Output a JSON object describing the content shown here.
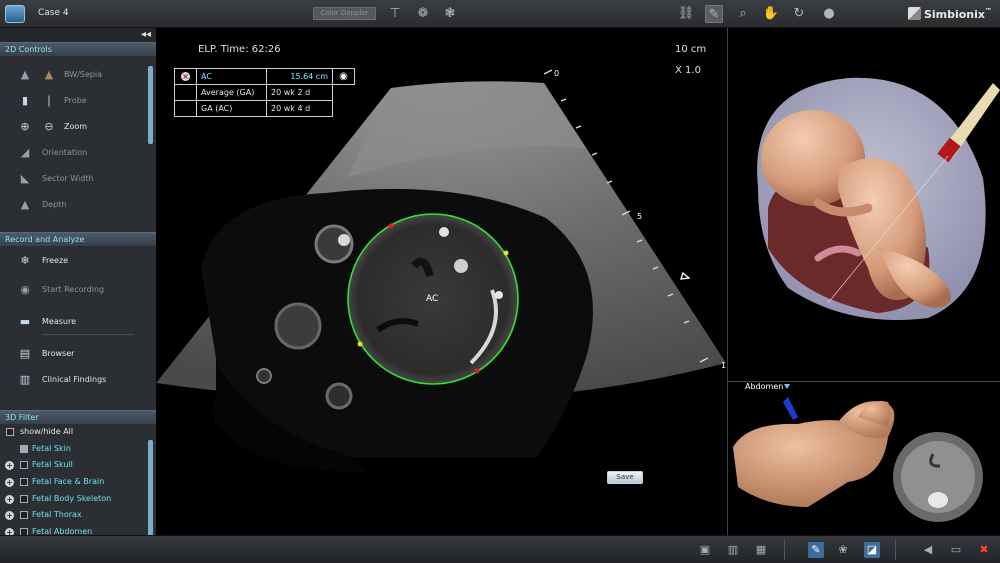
{
  "toolbar": {
    "case_title": "Case 4",
    "color_doppler": "Color Doppler",
    "brand": "Simbionix",
    "brand_suffix": "™"
  },
  "left_panel": {
    "collapse_icon": "double-left-arrow",
    "sections": {
      "controls_2d": "2D Controls",
      "record_analyze": "Record and Analyze",
      "filter_3d": "3D Filter"
    },
    "controls_2d": [
      {
        "label": "BW/Sepia",
        "icon": "sepia-icon"
      },
      {
        "label": "Probe",
        "icon": "probe-icon"
      },
      {
        "label": "Zoom",
        "icon": "zoom-icon"
      },
      {
        "label": "Orientation",
        "icon": "orientation-icon"
      },
      {
        "label": "Sector Width",
        "icon": "sector-width-icon"
      },
      {
        "label": "Depth",
        "icon": "depth-icon"
      }
    ],
    "record_analyze": [
      {
        "label": "Freeze",
        "icon": "freeze-icon"
      },
      {
        "label": "Start Recording",
        "icon": "record-icon"
      },
      {
        "label": "Measure",
        "icon": "ruler-icon"
      },
      {
        "label": "Browser",
        "icon": "browser-icon"
      },
      {
        "label": "Clinical Findings",
        "icon": "findings-icon"
      }
    ],
    "filter_3d": {
      "show_hide_all": "show/hide All",
      "items": [
        {
          "label": "Fetal Skin"
        },
        {
          "label": "Fetal Skull"
        },
        {
          "label": "Fetal Face & Brain"
        },
        {
          "label": "Fetal Body Skeleton"
        },
        {
          "label": "Fetal Thorax"
        },
        {
          "label": "Fetal Abdomen"
        }
      ]
    }
  },
  "ultrasound": {
    "elp_time": "ELP. Time: 62:26",
    "depth": "10 cm",
    "zoom": "X 1.0",
    "scale_labels": [
      "0",
      "5",
      "1"
    ],
    "measurement_label": "AC",
    "measurements": [
      {
        "name": "AC",
        "value": "15.64 cm"
      },
      {
        "name": "Average (GA)",
        "value": "20 wk 2 d"
      },
      {
        "name": "GA (AC)",
        "value": "20 wk 4 d"
      }
    ],
    "save_label": "Save"
  },
  "model_view": {
    "abdomen_label": "Abdomen"
  }
}
